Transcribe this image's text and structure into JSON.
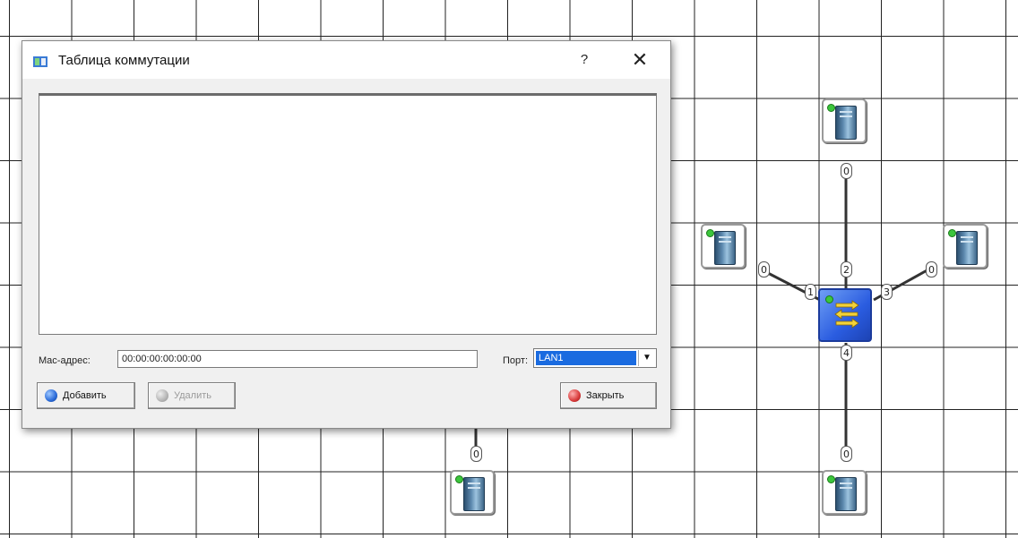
{
  "dialog": {
    "title": "Таблица коммутации",
    "help": "?",
    "close": "✕",
    "mac_label": "Mac-адрес:",
    "mac_value": "00:00:00:00:00:00",
    "port_label": "Порт:",
    "port_selected": "LAN1",
    "add_label": "Добавить",
    "delete_label": "Удалить",
    "close_label": "Закрыть"
  },
  "network": {
    "switch_ports": [
      "1",
      "2",
      "3",
      "4"
    ],
    "host_ports": [
      "0",
      "0",
      "0",
      "0",
      "0"
    ]
  },
  "colors": {
    "selection": "#1a6be0",
    "switch": "#2a5ce0",
    "led": "#3cc63c"
  }
}
